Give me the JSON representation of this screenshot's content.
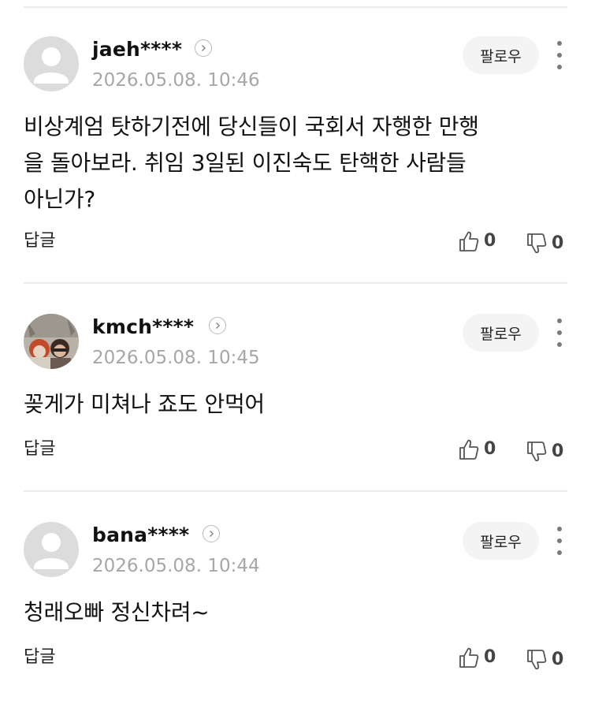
{
  "comments": [
    {
      "username": "jaeh****",
      "date": "2026.05.08. 10:46",
      "follow_label": "팔로우",
      "body_lines": [
        "비상계엄 탓하기전에 당신들이 국회서 자행한 만행",
        "을 돌아보라. 취임 3일된 이진숙도 탄핵한 사람들",
        "아닌가?"
      ],
      "reply_label": "답글",
      "like_count": "0",
      "dislike_count": "0",
      "avatar": "default-avatar-icon"
    },
    {
      "username": "kmch****",
      "date": "2026.05.08. 10:45",
      "follow_label": "팔로우",
      "body_lines": [
        "꽂게가 미쳐나 죠도 안먹어"
      ],
      "reply_label": "답글",
      "like_count": "0",
      "dislike_count": "0",
      "avatar": "photo-avatar"
    },
    {
      "username": "bana****",
      "date": "2026.05.08. 10:44",
      "follow_label": "팔로우",
      "body_lines": [
        "청래오빠 정신차려~"
      ],
      "reply_label": "답글",
      "like_count": "0",
      "dislike_count": "0",
      "avatar": "default-avatar-icon"
    }
  ],
  "colors": {
    "divider": "#ececec",
    "date": "#a7a7a7",
    "follow_bg": "#f4f4f4",
    "avatar_bg": "#d9d9d9"
  }
}
